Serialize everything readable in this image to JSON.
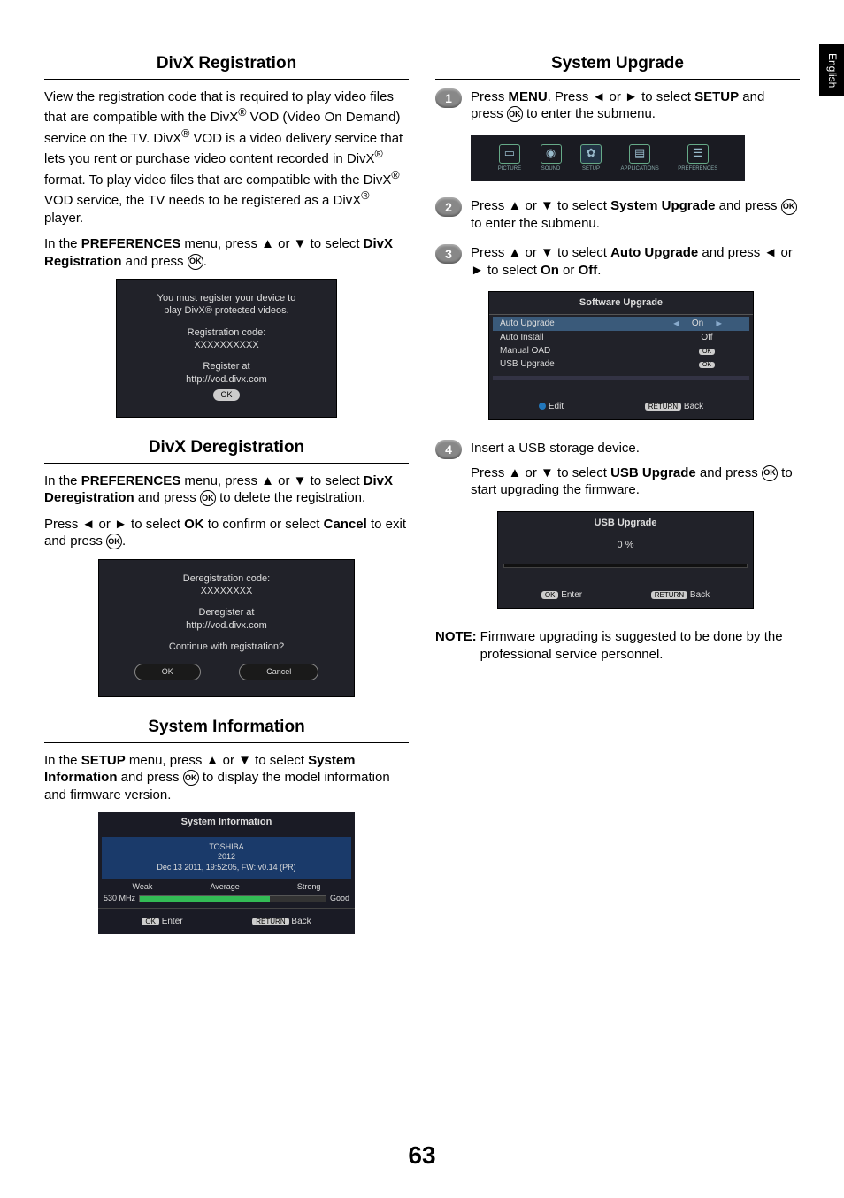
{
  "side_tab": "English",
  "page_number": "63",
  "left": {
    "divx_reg": {
      "title": "DivX Registration",
      "para1_a": "View the registration code that is required to play video files that are compatible with the DivX",
      "para1_b": " VOD (Video On Demand) service on the TV. DivX",
      "para1_c": " VOD is a video delivery service that lets you rent or purchase video content recorded in DivX",
      "para1_d": " format. To play video files that are compatible with the DivX",
      "para1_e": " VOD service, the TV needs to be registered as a DivX",
      "para1_f": " player.",
      "para2_a": "In the ",
      "para2_b": "PREFERENCES",
      "para2_c": " menu, press ▲ or ▼ to select ",
      "para2_d": "DivX Registration",
      "para2_e": " and press ",
      "osd": {
        "line1": "You must register your device to",
        "line2": "play DivX® protected videos.",
        "line3": "Registration code:",
        "line4": "XXXXXXXXXX",
        "line5": "Register at",
        "line6": "http://vod.divx.com",
        "btn": "OK"
      }
    },
    "divx_dereg": {
      "title": "DivX Deregistration",
      "para1_a": "In the ",
      "para1_b": "PREFERENCES",
      "para1_c": " menu, press ▲ or ▼ to select ",
      "para1_d": "DivX Deregistration",
      "para1_e": " and press ",
      "para1_f": " to delete the registration.",
      "para2_a": "Press ◄ or ► to select ",
      "para2_b": "OK",
      "para2_c": " to confirm or select ",
      "para2_d": "Cancel",
      "para2_e": " to exit and press ",
      "osd": {
        "line1": "Deregistration code:",
        "line2": "XXXXXXXX",
        "line3": "Deregister at",
        "line4": "http://vod.divx.com",
        "line5": "Continue with registration?",
        "btn_ok": "OK",
        "btn_cancel": "Cancel"
      }
    },
    "sys_info": {
      "title": "System Information",
      "para_a": "In the ",
      "para_b": "SETUP",
      "para_c": " menu, press ▲ or ▼ to select ",
      "para_d": "System Information",
      "para_e": " and press ",
      "para_f": " to display the model information and firmware version.",
      "osd": {
        "header": "System Information",
        "brand": "TOSHIBA",
        "year": "2012",
        "build": "Dec 13 2011, 19:52:05, FW: v0.14 (PR)",
        "weak": "Weak",
        "avg": "Average",
        "strong": "Strong",
        "freq": "530 MHz",
        "quality": "Good",
        "enter_pill": "OK",
        "enter": "Enter",
        "return_pill": "RETURN",
        "back": "Back"
      }
    }
  },
  "right": {
    "title": "System Upgrade",
    "step1_a": "Press ",
    "step1_b": "MENU",
    "step1_c": ". Press ◄ or ► to select ",
    "step1_d": "SETUP",
    "step1_e": " and press ",
    "step1_f": " to enter  the submenu.",
    "menu_icons": {
      "picture": "PICTURE",
      "sound": "SOUND",
      "setup": "SETUP",
      "applications": "APPLICATIONS",
      "preferences": "PREFERENCES"
    },
    "step2_a": "Press ▲ or ▼ to select ",
    "step2_b": "System Upgrade",
    "step2_c": " and press ",
    "step2_d": " to enter the submenu.",
    "step3_a": "Press ▲ or ▼ to select ",
    "step3_b": "Auto Upgrade",
    "step3_c": " and press ◄ or ► to select ",
    "step3_d": "On",
    "step3_e": " or ",
    "step3_f": "Off",
    "upgrade_osd": {
      "header": "Software Upgrade",
      "r1_label": "Auto Upgrade",
      "r1_value": "On",
      "r2_label": "Auto Install",
      "r2_value": "Off",
      "r3_label": "Manual OAD",
      "r3_value": "OK",
      "r4_label": "USB Upgrade",
      "r4_value": "OK",
      "edit": "Edit",
      "return_pill": "RETURN",
      "back": "Back"
    },
    "step4_a": "Insert a USB storage device.",
    "step4_b": "Press ▲ or ▼ to select ",
    "step4_c": "USB Upgrade",
    "step4_d": " and press ",
    "step4_e": " to start upgrading the firmware.",
    "usb_osd": {
      "header": "USB Upgrade",
      "pct": "0 %",
      "enter_pill": "OK",
      "enter": "Enter",
      "return_pill": "RETURN",
      "back": "Back"
    },
    "note_label": "NOTE:",
    "note_text": " Firmware upgrading is suggested to be done by the professional service personnel."
  },
  "ok_label": "OK"
}
